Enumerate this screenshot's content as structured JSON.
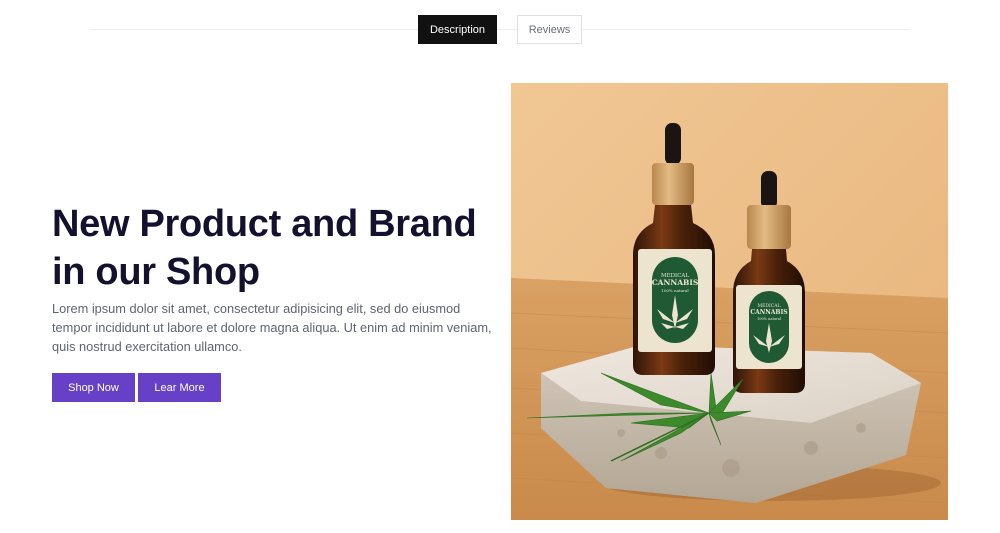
{
  "tabs": [
    {
      "label": "Description",
      "active": true
    },
    {
      "label": "Reviews",
      "active": false
    }
  ],
  "hero": {
    "title_line1": "New Product and Brand",
    "title_line2": "in our Shop",
    "description": "Lorem ipsum dolor sit amet, consectetur adipisicing elit, sed do eiusmod tempor incididunt ut labore et dolore magna aliqua. Ut enim ad minim veniam, quis nostrud exercitation ullamco.",
    "buttons": {
      "shop_now": "Shop Now",
      "learn_more": "Lear More"
    }
  },
  "product_image": {
    "label_line1": "MEDICAL",
    "label_line2": "CANNABIS",
    "label_line3": "100% natural"
  },
  "colors": {
    "accent": "#6640c6",
    "active_tab": "#111111",
    "heading": "#14112e",
    "body_text": "#5e6470"
  }
}
